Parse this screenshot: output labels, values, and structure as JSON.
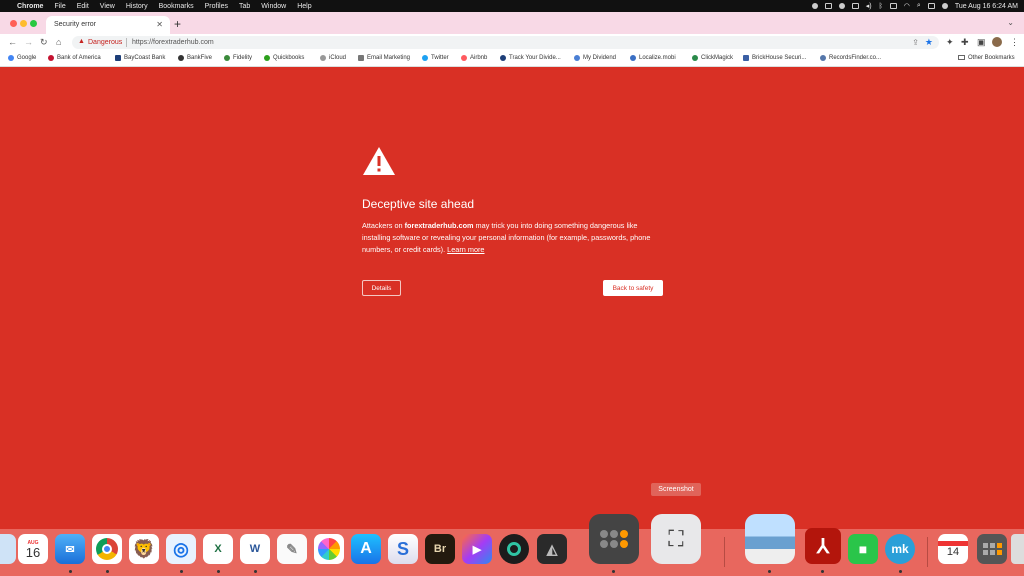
{
  "menubar": {
    "app": "Chrome",
    "menus": [
      "File",
      "Edit",
      "View",
      "History",
      "Bookmarks",
      "Profiles",
      "Tab",
      "Window",
      "Help"
    ],
    "datetime": "Tue Aug 16  6:24 AM"
  },
  "tab": {
    "title": "Security error"
  },
  "address": {
    "security_label": "Dangerous",
    "url": "https://forextraderhub.com"
  },
  "bookmarks": {
    "items": [
      "Google",
      "Bank of America",
      "BayCoast Bank",
      "BankFive",
      "Fidelity",
      "Quickbooks",
      "iCloud",
      "Email Marketing",
      "Twitter",
      "Airbnb",
      "Track Your Divide...",
      "My Dividend",
      "Localize.mobi",
      "ClickMagick",
      "BrickHouse Securi...",
      "RecordsFinder.co..."
    ],
    "other": "Other Bookmarks"
  },
  "interstitial": {
    "heading": "Deceptive site ahead",
    "desc_pre": "Attackers on ",
    "desc_domain": "forextraderhub.com",
    "desc_post": " may trick you into doing something dangerous like installing software or revealing your personal information (for example, passwords, phone numbers, or credit cards). ",
    "learn_more": "Learn more",
    "details_label": "Details",
    "safety_label": "Back to safety"
  },
  "tooltip": "Screenshot",
  "dock": {
    "calendar_month": "AUG",
    "calendar_day": "16",
    "calendar2_day": "14",
    "bridge_label": "Br",
    "mk_label": "mk",
    "icons": [
      "finder-icon",
      "calendar-icon",
      "mail-icon",
      "chrome-icon",
      "brave-icon",
      "safari-icon",
      "excel-icon",
      "word-icon",
      "textedit-icon",
      "photos-icon",
      "app-store-icon",
      "scrivener-icon",
      "bridge-icon",
      "final-cut-icon",
      "dj-icon",
      "preview-icon",
      "calculator-icon",
      "screenshot-icon",
      "photo-viewer-icon",
      "acrobat-icon",
      "facetime-icon",
      "mk-icon",
      "calendar-doc-icon",
      "calculator-doc-icon",
      "trash-icon"
    ]
  }
}
